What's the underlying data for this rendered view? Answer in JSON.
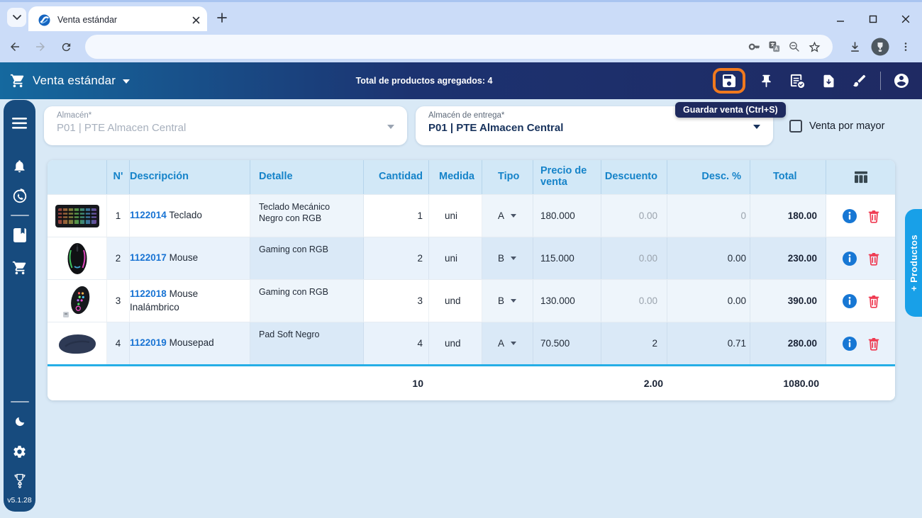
{
  "browser": {
    "tab_title": "Venta estándar"
  },
  "navbar": {
    "title": "Venta estándar",
    "summary": "Total de productos agregados: 4",
    "save_tooltip": "Guardar venta (Ctrl+S)"
  },
  "filters": {
    "almacen_label": "Almacén*",
    "almacen_value": "P01 | PTE Almacen Central",
    "entrega_label": "Almacén de entrega*",
    "entrega_value": "P01 | PTE Almacen Central",
    "wholesale_label": "Venta por mayor",
    "wholesale_checked": false
  },
  "table": {
    "headers": {
      "n": "N'",
      "descripcion": "Descripción",
      "detalle": "Detalle",
      "cantidad": "Cantidad",
      "medida": "Medida",
      "tipo": "Tipo",
      "precio": "Precio de venta",
      "descuento": "Descuento",
      "desc_pct": "Desc. %",
      "total": "Total"
    },
    "rows": [
      {
        "n": "1",
        "code": "1122014",
        "name": "Teclado",
        "detalle": "Teclado Mecánico Negro con RGB",
        "cantidad": "1",
        "medida": "uni",
        "tipo": "A",
        "precio": "180.000",
        "descuento": "0.00",
        "desc_pct": "0",
        "total": "180.00",
        "image": "keyboard-rgb"
      },
      {
        "n": "2",
        "code": "1122017",
        "name": "Mouse",
        "detalle": "Gaming con RGB",
        "cantidad": "2",
        "medida": "uni",
        "tipo": "B",
        "precio": "115.000",
        "descuento": "0.00",
        "desc_pct": "0.00",
        "total": "230.00",
        "image": "mouse-rgb"
      },
      {
        "n": "3",
        "code": "1122018",
        "name": "Mouse Inalámbrico",
        "detalle": "Gaming con RGB",
        "cantidad": "3",
        "medida": "und",
        "tipo": "B",
        "precio": "130.000",
        "descuento": "0.00",
        "desc_pct": "0.00",
        "total": "390.00",
        "image": "mouse-wireless-rgb"
      },
      {
        "n": "4",
        "code": "1122019",
        "name": "Mousepad",
        "detalle": "Pad Soft Negro",
        "cantidad": "4",
        "medida": "und",
        "tipo": "A",
        "precio": "70.500",
        "descuento": "2",
        "desc_pct": "0.71",
        "total": "280.00",
        "image": "mousepad-navy"
      }
    ],
    "totals": {
      "cantidad": "10",
      "descuento": "2.00",
      "total": "1080.00"
    }
  },
  "products_tab_label": "+ Productos",
  "sidebar": {
    "version": "v5.1.28"
  },
  "colors": {
    "accent_orange": "#F0791E",
    "navbar_teal": "#15699F",
    "navbar_navy": "#1F2A63",
    "sidebar_navy": "#174B7E",
    "header_blue": "#1583C9",
    "link_blue": "#1873D3",
    "danger_red": "#EF3B52",
    "products_tab_blue": "#18A0E8",
    "cyan_rule": "#25AEE6"
  }
}
